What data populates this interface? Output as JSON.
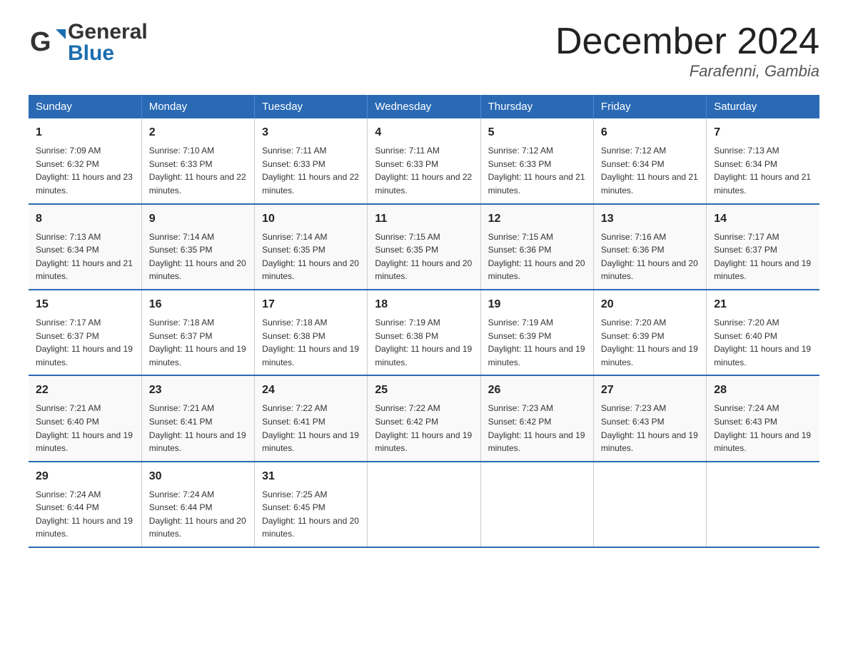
{
  "logo": {
    "line1": "General",
    "line2": "Blue"
  },
  "title": "December 2024",
  "location": "Farafenni, Gambia",
  "days_of_week": [
    "Sunday",
    "Monday",
    "Tuesday",
    "Wednesday",
    "Thursday",
    "Friday",
    "Saturday"
  ],
  "weeks": [
    [
      {
        "day": "1",
        "sunrise": "7:09 AM",
        "sunset": "6:32 PM",
        "daylight": "11 hours and 23 minutes."
      },
      {
        "day": "2",
        "sunrise": "7:10 AM",
        "sunset": "6:33 PM",
        "daylight": "11 hours and 22 minutes."
      },
      {
        "day": "3",
        "sunrise": "7:11 AM",
        "sunset": "6:33 PM",
        "daylight": "11 hours and 22 minutes."
      },
      {
        "day": "4",
        "sunrise": "7:11 AM",
        "sunset": "6:33 PM",
        "daylight": "11 hours and 22 minutes."
      },
      {
        "day": "5",
        "sunrise": "7:12 AM",
        "sunset": "6:33 PM",
        "daylight": "11 hours and 21 minutes."
      },
      {
        "day": "6",
        "sunrise": "7:12 AM",
        "sunset": "6:34 PM",
        "daylight": "11 hours and 21 minutes."
      },
      {
        "day": "7",
        "sunrise": "7:13 AM",
        "sunset": "6:34 PM",
        "daylight": "11 hours and 21 minutes."
      }
    ],
    [
      {
        "day": "8",
        "sunrise": "7:13 AM",
        "sunset": "6:34 PM",
        "daylight": "11 hours and 21 minutes."
      },
      {
        "day": "9",
        "sunrise": "7:14 AM",
        "sunset": "6:35 PM",
        "daylight": "11 hours and 20 minutes."
      },
      {
        "day": "10",
        "sunrise": "7:14 AM",
        "sunset": "6:35 PM",
        "daylight": "11 hours and 20 minutes."
      },
      {
        "day": "11",
        "sunrise": "7:15 AM",
        "sunset": "6:35 PM",
        "daylight": "11 hours and 20 minutes."
      },
      {
        "day": "12",
        "sunrise": "7:15 AM",
        "sunset": "6:36 PM",
        "daylight": "11 hours and 20 minutes."
      },
      {
        "day": "13",
        "sunrise": "7:16 AM",
        "sunset": "6:36 PM",
        "daylight": "11 hours and 20 minutes."
      },
      {
        "day": "14",
        "sunrise": "7:17 AM",
        "sunset": "6:37 PM",
        "daylight": "11 hours and 19 minutes."
      }
    ],
    [
      {
        "day": "15",
        "sunrise": "7:17 AM",
        "sunset": "6:37 PM",
        "daylight": "11 hours and 19 minutes."
      },
      {
        "day": "16",
        "sunrise": "7:18 AM",
        "sunset": "6:37 PM",
        "daylight": "11 hours and 19 minutes."
      },
      {
        "day": "17",
        "sunrise": "7:18 AM",
        "sunset": "6:38 PM",
        "daylight": "11 hours and 19 minutes."
      },
      {
        "day": "18",
        "sunrise": "7:19 AM",
        "sunset": "6:38 PM",
        "daylight": "11 hours and 19 minutes."
      },
      {
        "day": "19",
        "sunrise": "7:19 AM",
        "sunset": "6:39 PM",
        "daylight": "11 hours and 19 minutes."
      },
      {
        "day": "20",
        "sunrise": "7:20 AM",
        "sunset": "6:39 PM",
        "daylight": "11 hours and 19 minutes."
      },
      {
        "day": "21",
        "sunrise": "7:20 AM",
        "sunset": "6:40 PM",
        "daylight": "11 hours and 19 minutes."
      }
    ],
    [
      {
        "day": "22",
        "sunrise": "7:21 AM",
        "sunset": "6:40 PM",
        "daylight": "11 hours and 19 minutes."
      },
      {
        "day": "23",
        "sunrise": "7:21 AM",
        "sunset": "6:41 PM",
        "daylight": "11 hours and 19 minutes."
      },
      {
        "day": "24",
        "sunrise": "7:22 AM",
        "sunset": "6:41 PM",
        "daylight": "11 hours and 19 minutes."
      },
      {
        "day": "25",
        "sunrise": "7:22 AM",
        "sunset": "6:42 PM",
        "daylight": "11 hours and 19 minutes."
      },
      {
        "day": "26",
        "sunrise": "7:23 AM",
        "sunset": "6:42 PM",
        "daylight": "11 hours and 19 minutes."
      },
      {
        "day": "27",
        "sunrise": "7:23 AM",
        "sunset": "6:43 PM",
        "daylight": "11 hours and 19 minutes."
      },
      {
        "day": "28",
        "sunrise": "7:24 AM",
        "sunset": "6:43 PM",
        "daylight": "11 hours and 19 minutes."
      }
    ],
    [
      {
        "day": "29",
        "sunrise": "7:24 AM",
        "sunset": "6:44 PM",
        "daylight": "11 hours and 19 minutes."
      },
      {
        "day": "30",
        "sunrise": "7:24 AM",
        "sunset": "6:44 PM",
        "daylight": "11 hours and 20 minutes."
      },
      {
        "day": "31",
        "sunrise": "7:25 AM",
        "sunset": "6:45 PM",
        "daylight": "11 hours and 20 minutes."
      },
      null,
      null,
      null,
      null
    ]
  ]
}
